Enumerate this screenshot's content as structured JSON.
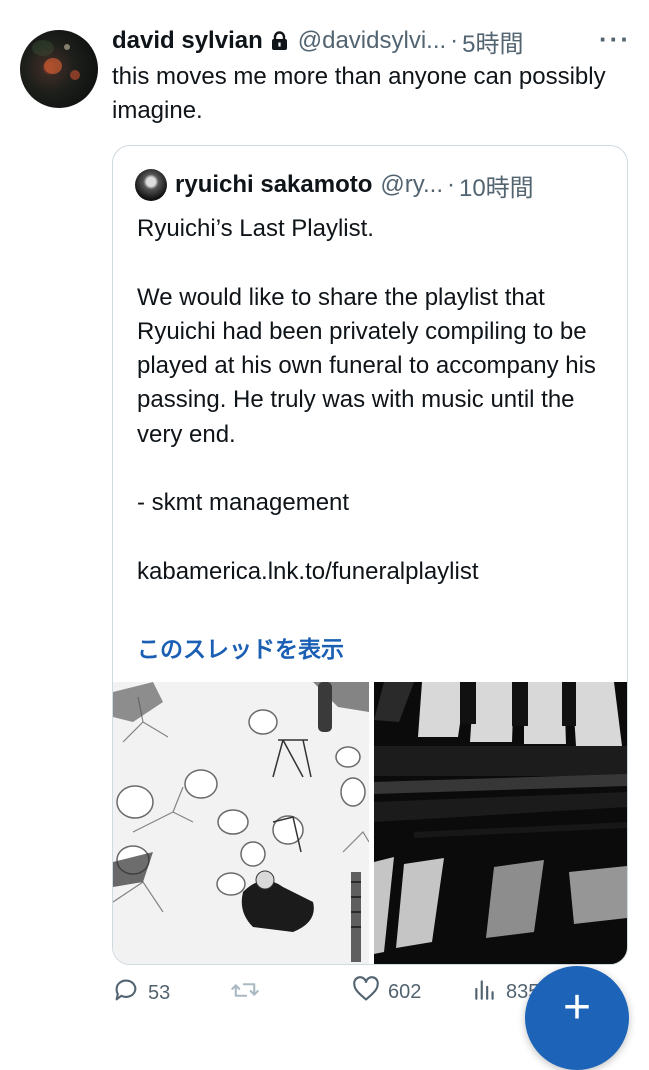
{
  "tweet": {
    "author_name": "david sylvian",
    "author_handle": "@davidsylvi...",
    "separator": "·",
    "time": "5時間",
    "more": "···",
    "text": "this moves me more than anyone can possibly imagine."
  },
  "quote": {
    "author_name": "ryuichi sakamoto",
    "author_handle": "@ry...",
    "separator": "·",
    "time": "10時間",
    "lines": [
      "Ryuichi’s Last Playlist.",
      "We would like to share the playlist that Ryuichi had been privately compiling to be played at his own funeral to accompany his passing. He truly was with music until the very end.",
      "- skmt management",
      "kabamerica.lnk.to/funeralplaylist"
    ],
    "show_thread": "このスレッドを表示"
  },
  "actions": {
    "replies": "53",
    "retweets": "",
    "likes": "602",
    "views": "835"
  },
  "fab_label": "+",
  "colors": {
    "link": "#1a5fb4",
    "secondary_text": "#536471",
    "fab": "#1d64b8"
  },
  "icons": [
    "lock-icon",
    "more-icon",
    "reply-icon",
    "retweet-icon",
    "like-icon",
    "views-icon",
    "compose-plus-icon"
  ]
}
